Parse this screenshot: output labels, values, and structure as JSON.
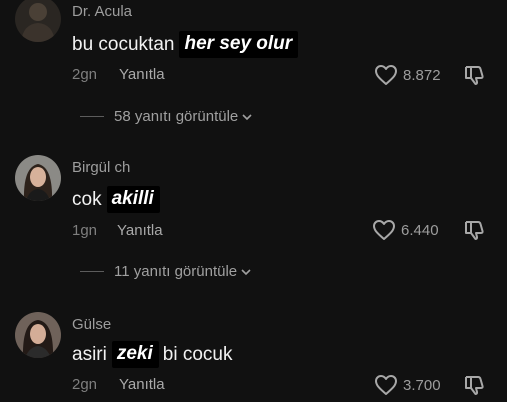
{
  "colors": {
    "background": "#111111",
    "highlight_bg": "#000000",
    "muted_text": "#7f7f7f"
  },
  "comments": [
    {
      "username": "Dr. Acula",
      "text_before": "bu cocuktan",
      "highlight": "her sey olur",
      "text_after": "",
      "age": "2gn",
      "reply_label": "Yanıtla",
      "likes": "8.872",
      "replies_label": "58 yanıtı görüntüle"
    },
    {
      "username": "Birgül ch",
      "text_before": "cok",
      "highlight": "akilli",
      "text_after": "",
      "age": "1gn",
      "reply_label": "Yanıtla",
      "likes": "6.440",
      "replies_label": "11 yanıtı görüntüle"
    },
    {
      "username": "Gülse",
      "text_before": "asiri",
      "highlight": "zeki",
      "text_after": "bi cocuk",
      "age": "2gn",
      "reply_label": "Yanıtla",
      "likes": "3.700"
    }
  ],
  "icons": {
    "like": "heart-outline-icon",
    "dislike": "thumbs-down-outline-icon",
    "expand": "chevron-down-icon"
  }
}
